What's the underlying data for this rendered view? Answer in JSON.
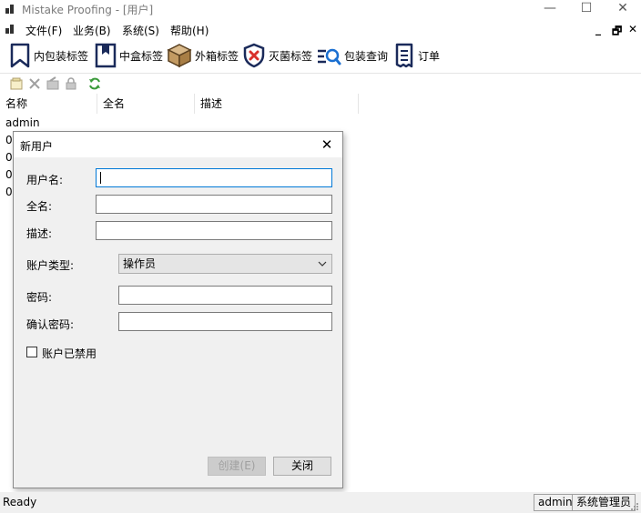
{
  "window": {
    "title": "Mistake Proofing - [用户]",
    "minimize": "—",
    "maximize": "☐",
    "close": "✕"
  },
  "menubar": {
    "items": [
      {
        "label": "文件(F)"
      },
      {
        "label": "业务(B)"
      },
      {
        "label": "系统(S)"
      },
      {
        "label": "帮助(H)"
      }
    ],
    "mdi_minimize": "_",
    "mdi_restore": "🗗",
    "mdi_close": "✕"
  },
  "toolbar": {
    "buttons": [
      {
        "label": "内包装标签",
        "icon": "inner-label-icon"
      },
      {
        "label": "中盒标签",
        "icon": "middle-box-icon"
      },
      {
        "label": "外箱标签",
        "icon": "outer-box-icon"
      },
      {
        "label": "灭菌标签",
        "icon": "sterilization-shield-icon"
      },
      {
        "label": "包装查询",
        "icon": "package-search-icon"
      },
      {
        "label": "订单",
        "icon": "order-doc-icon"
      }
    ]
  },
  "listview": {
    "columns": [
      "名称",
      "全名",
      "描述"
    ],
    "rows": [
      "admin",
      "0",
      "0",
      "0",
      "0"
    ]
  },
  "dialog": {
    "title": "新用户",
    "close": "✕",
    "username_label": "用户名:",
    "username_value": "",
    "fullname_label": "全名:",
    "fullname_value": "",
    "description_label": "描述:",
    "description_value": "",
    "account_type_label": "账户类型:",
    "account_type_value": "操作员",
    "password_label": "密码:",
    "password_value": "",
    "confirm_password_label": "确认密码:",
    "confirm_password_value": "",
    "disabled_checkbox_label": "账户已禁用",
    "disabled_checked": false,
    "create_button": "创建(E)",
    "close_button": "关闭"
  },
  "statusbar": {
    "status": "Ready",
    "user": "admin",
    "role": "系统管理员"
  },
  "colors": {
    "focus_border": "#0078d7",
    "dialog_bg": "#f0f0f0"
  }
}
